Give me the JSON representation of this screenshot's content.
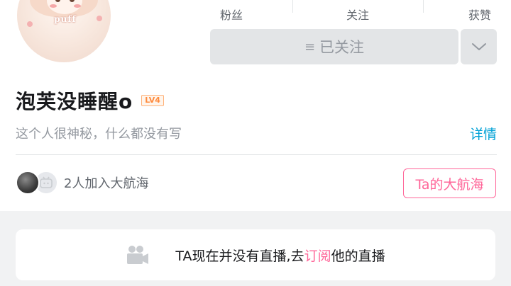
{
  "profile": {
    "avatar_text": "puff",
    "username": "泡芙没睡醒o",
    "level": "LV4",
    "bio": "这个人很神秘，什么都没有写",
    "detail_label": "详情"
  },
  "stats": [
    {
      "label": "粉丝"
    },
    {
      "label": "关注"
    },
    {
      "label": "获赞"
    }
  ],
  "actions": {
    "follow_label": "已关注",
    "follow_icon": "menu-lines-icon",
    "more_icon": "chevron-down-icon"
  },
  "fans": {
    "text": "2人加入大航海",
    "button_label": "Ta的大航海"
  },
  "live": {
    "text_before": "TA现在并没有直播,去",
    "link_text": "订阅",
    "text_after": "他的直播",
    "icon": "camera-icon"
  },
  "colors": {
    "accent_pink": "#ff6699",
    "link_blue": "#00a1d6",
    "level_orange": "#ff8a3d",
    "button_gray": "#e3e5e7"
  }
}
